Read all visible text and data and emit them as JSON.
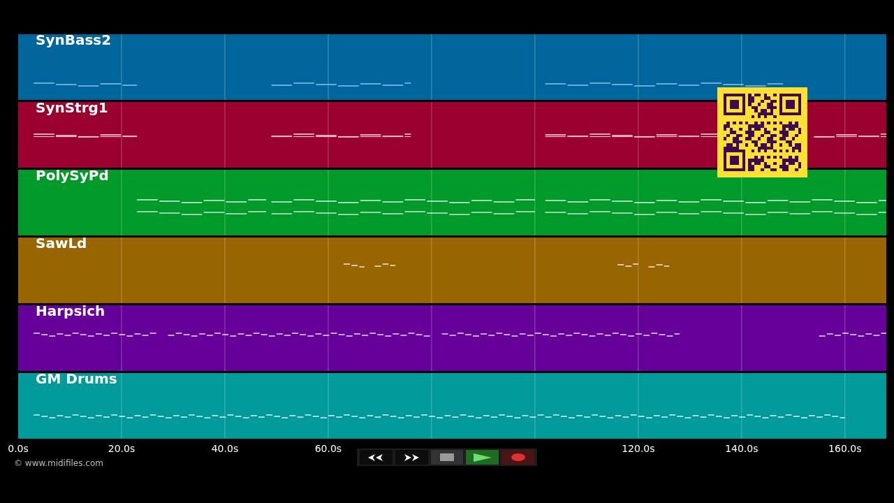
{
  "tracks": [
    {
      "name": "SynBass2",
      "color": "#00659a"
    },
    {
      "name": "SynStrg1",
      "color": "#990030"
    },
    {
      "name": "PolySyPd",
      "color": "#009a2a"
    },
    {
      "name": "SawLd",
      "color": "#986500"
    },
    {
      "name": "Harpsich",
      "color": "#650099"
    },
    {
      "name": "GM Drums",
      "color": "#009a9a"
    }
  ],
  "axis": {
    "ticks": [
      "0.0s",
      "20.0s",
      "40.0s",
      "60.0s",
      "120.0s",
      "140.0s",
      "160.0s"
    ]
  },
  "credit": "© www.midifiles.com",
  "transport": [
    {
      "kind": "rewind"
    },
    {
      "kind": "forward"
    },
    {
      "kind": "stop"
    },
    {
      "kind": "play"
    },
    {
      "kind": "record"
    }
  ]
}
